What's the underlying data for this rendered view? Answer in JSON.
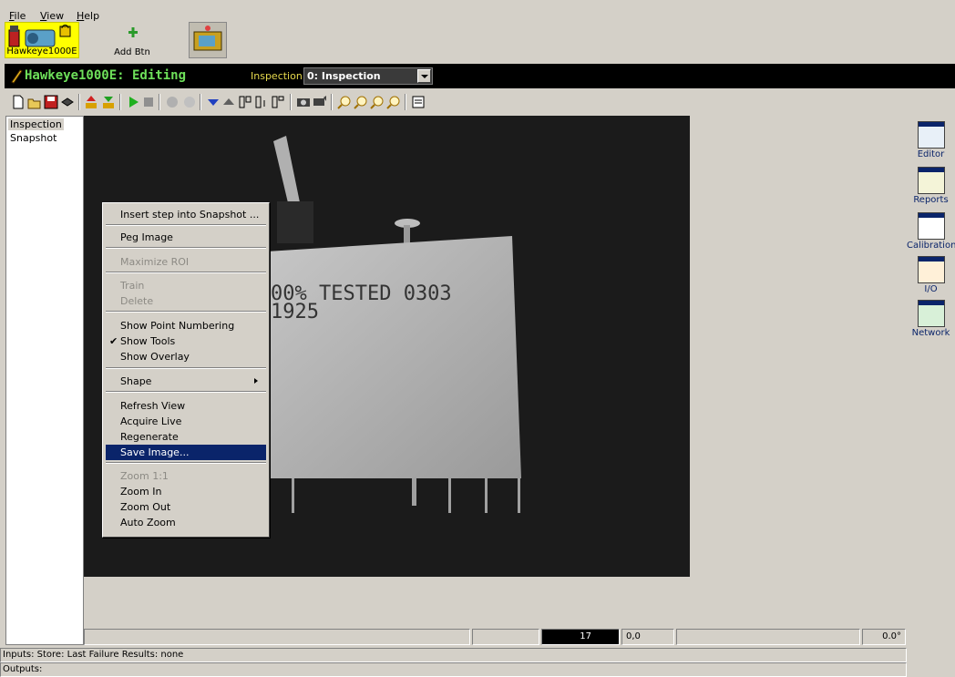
{
  "menu": [
    {
      "key": "file",
      "label": "File"
    },
    {
      "key": "view",
      "label": "View"
    },
    {
      "key": "help",
      "label": "Help"
    }
  ],
  "devices": {
    "selected_label": "Hawkeye1000E",
    "add_label": "Add Btn"
  },
  "titlebar": {
    "title": "Hawkeye1000E: Editing",
    "inspection_label": "Inspection:",
    "inspection_value": "0: Inspection"
  },
  "toolbar": {
    "icons": [
      "new-icon",
      "open-icon",
      "save-icon",
      "stack-icon",
      "upload-icon",
      "download-icon",
      "run-icon",
      "stop-icon",
      "step-icon",
      "step-disabled-icon",
      "move-down-icon",
      "move-up-icon",
      "insert-before-icon",
      "insert-after-icon",
      "insert-child-icon",
      "camera-icon",
      "camera-live-icon",
      "zoom-in-icon",
      "zoom-out-icon",
      "zoom-fit-icon",
      "zoom-1-icon",
      "properties-icon"
    ]
  },
  "tree": {
    "items": [
      "Inspection",
      "Snapshot"
    ]
  },
  "image": {
    "text_line1": "00% TESTED 0303",
    "text_line2": "1925"
  },
  "context_menu": {
    "items": [
      {
        "label": "Insert step into Snapshot ...",
        "state": "normal"
      },
      {
        "label": "Peg Image",
        "state": "normal"
      },
      {
        "label": "Maximize ROI",
        "state": "disabled"
      },
      {
        "label": "Train",
        "state": "disabled"
      },
      {
        "label": "Delete",
        "state": "disabled"
      },
      {
        "label": "Show Point Numbering",
        "state": "normal"
      },
      {
        "label": "Show Tools",
        "state": "checked"
      },
      {
        "label": "Show Overlay",
        "state": "normal"
      },
      {
        "label": "Shape",
        "state": "submenu"
      },
      {
        "label": "Refresh View",
        "state": "normal"
      },
      {
        "label": "Acquire Live",
        "state": "normal"
      },
      {
        "label": "Regenerate",
        "state": "normal"
      },
      {
        "label": "Save Image...",
        "state": "highlighted"
      },
      {
        "label": "Zoom 1:1",
        "state": "disabled"
      },
      {
        "label": "Zoom In",
        "state": "normal"
      },
      {
        "label": "Zoom Out",
        "state": "normal"
      },
      {
        "label": "Auto Zoom",
        "state": "normal"
      }
    ]
  },
  "statusbar": {
    "frame": "17",
    "coords": "0,0",
    "angle": "0.0°"
  },
  "right_panel": {
    "items": [
      {
        "label": "Editor"
      },
      {
        "label": "Reports"
      },
      {
        "label": "Calibration"
      },
      {
        "label": "I/O"
      },
      {
        "label": "Network"
      }
    ]
  },
  "bottom": {
    "inputs": "Inputs: Store: Last Failure  Results: none",
    "outputs": "Outputs:"
  },
  "colors": {
    "title_green": "#6ee05a",
    "inspection_label_yellow": "#e6d94d",
    "highlight_blue": "#0a246a",
    "device_yellow": "#ffff00"
  }
}
